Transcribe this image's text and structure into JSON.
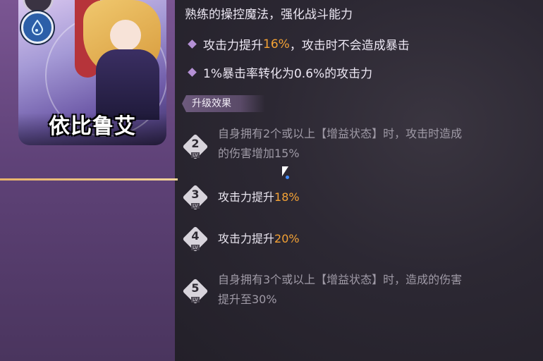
{
  "character": {
    "name": "依比鲁艾"
  },
  "skill": {
    "description": "熟练的操控魔法，强化战斗能力",
    "bullets": [
      {
        "pre": "攻击力提升",
        "hl": "16%",
        "post": "，攻击时不会造成暴击"
      },
      {
        "text": "1%暴击率转化为0.6%的攻击力"
      }
    ]
  },
  "upgrade": {
    "title": "升级效果",
    "lv_tag": "LV",
    "levels": [
      {
        "num": "2",
        "line1": "自身拥有2个或以上【增益状态】时，攻击时造成",
        "line2": "的伤害增加15%"
      },
      {
        "num": "3",
        "pre": "攻击力提升",
        "hl": "18%"
      },
      {
        "num": "4",
        "pre": "攻击力提升",
        "hl": "20%"
      },
      {
        "num": "5",
        "line1": "自身拥有3个或以上【增益状态】时，造成的伤害",
        "line2": "提升至30%"
      }
    ]
  },
  "icons": {
    "skill": "water-drop-icon"
  },
  "colors": {
    "highlight": "#f4a235",
    "accent": "#b591d6"
  }
}
